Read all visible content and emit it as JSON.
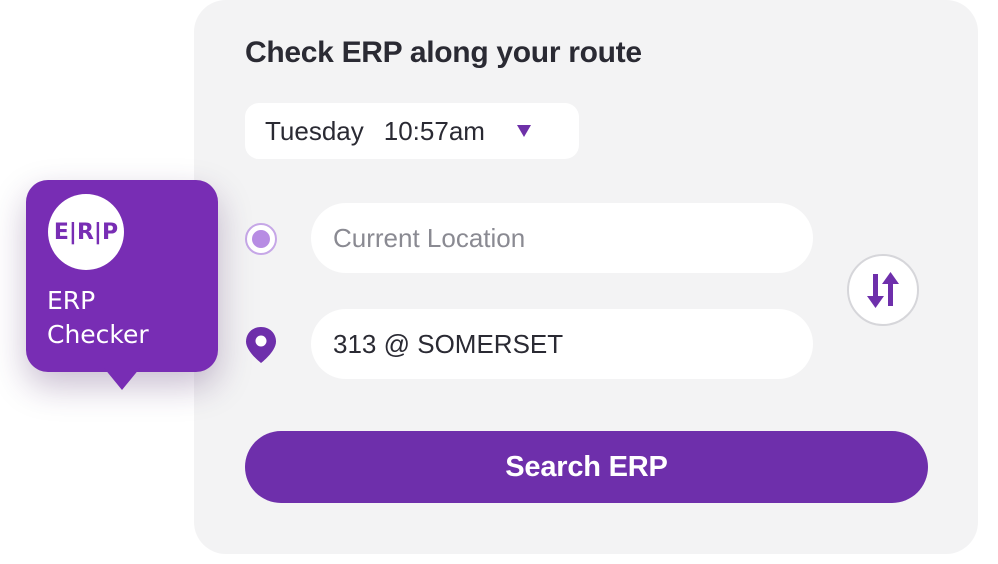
{
  "badge": {
    "logo_text": "E|R|P",
    "name_line1": "ERP",
    "name_line2": "Checker"
  },
  "form": {
    "title": "Check ERP along your route",
    "day": "Tuesday",
    "time": "10:57am",
    "origin": {
      "placeholder": "Current Location",
      "value": ""
    },
    "destination": {
      "placeholder": "",
      "value": "313 @ SOMERSET"
    },
    "search_label": "Search ERP"
  },
  "icons": {
    "origin": "origin-dot-icon",
    "destination": "location-pin-icon",
    "swap": "swap-arrows-icon",
    "dropdown": "caret-down-icon"
  },
  "colors": {
    "brand_purple": "#782db4",
    "button_purple": "#6e2fab",
    "origin_dot": "#b78ce3",
    "card_background": "#f3f3f4",
    "title_text": "#2a2a33"
  }
}
